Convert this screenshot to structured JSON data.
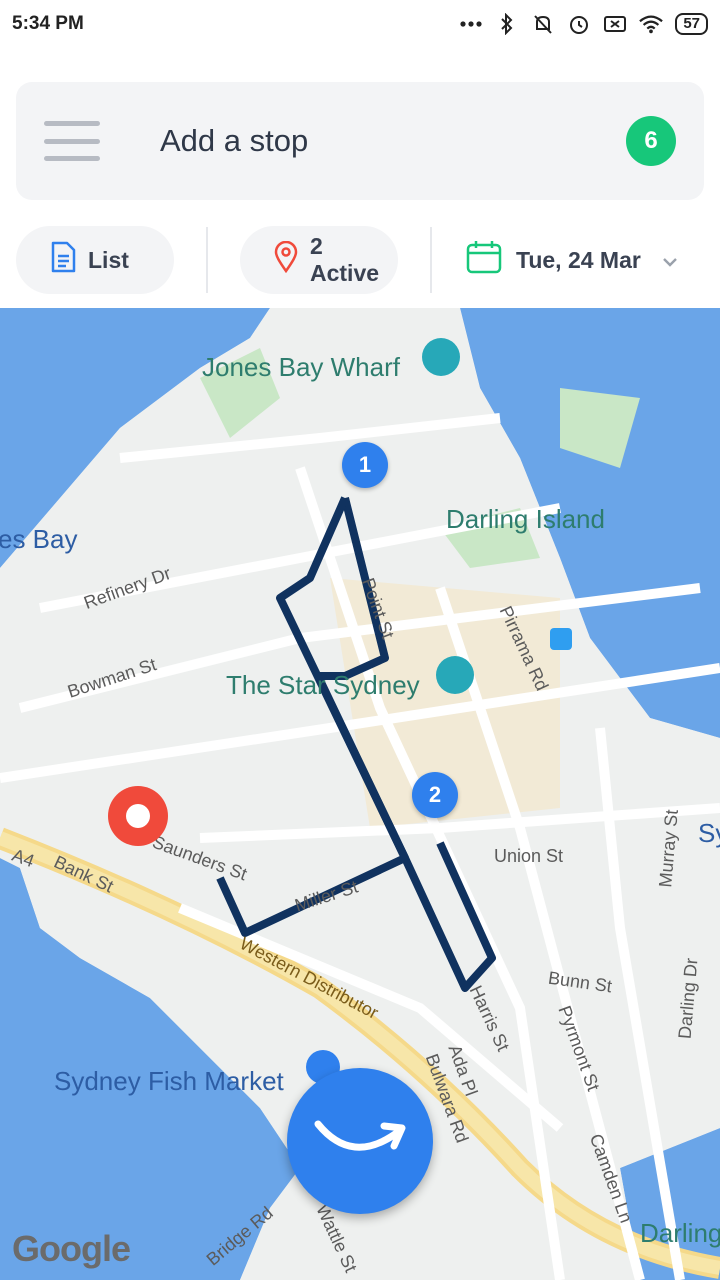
{
  "status_bar": {
    "time": "5:34 PM",
    "battery": "57",
    "icons": [
      "more-dots-icon",
      "bluetooth-icon",
      "mute-icon",
      "alarm-icon",
      "sim-icon",
      "wifi-icon",
      "battery-icon"
    ]
  },
  "search": {
    "label": "Add a stop",
    "stop_count": "6",
    "menu_icon": "hamburger-icon"
  },
  "filters": {
    "list_label": "List",
    "active_label": "2 Active",
    "date_label": "Tue, 24 Mar"
  },
  "map": {
    "places": {
      "jones_bay_wharf": "Jones Bay Wharf",
      "darling_island": "Darling Island",
      "the_star": "The Star Sydney",
      "sydney_fish_market": "Sydney Fish Market",
      "bay_fragment": "es Bay",
      "darling_fragment": "Darling",
      "sy_fragment": "Sy"
    },
    "streets": {
      "refinery": "Refinery Dr",
      "bowman": "Bowman St",
      "point": "Point St",
      "pirrama": "Pirrama Rd",
      "union": "Union St",
      "murray": "Murray St",
      "saunders": "Saunders St",
      "bank": "Bank St",
      "miller": "Miller St",
      "western": "Western Distributor",
      "bunn": "Bunn St",
      "harris": "Harris St",
      "ada": "Ada Pl",
      "bulwara": "Bulwara Rd",
      "pyrmont": "Pyrmont St",
      "darling_dr": "Darling Dr",
      "camden": "Camden Ln",
      "bridge": "Bridge Rd",
      "wattle": "Wattle St",
      "a4": "A4"
    },
    "markers": [
      "1",
      "2"
    ],
    "attribution": "Google"
  },
  "colors": {
    "accent_blue": "#2f80ed",
    "green_badge": "#17c77a",
    "route": "#10325f",
    "water": "#6aa5e8",
    "park": "#c9e7c6",
    "pin_red": "#f04a3b"
  }
}
